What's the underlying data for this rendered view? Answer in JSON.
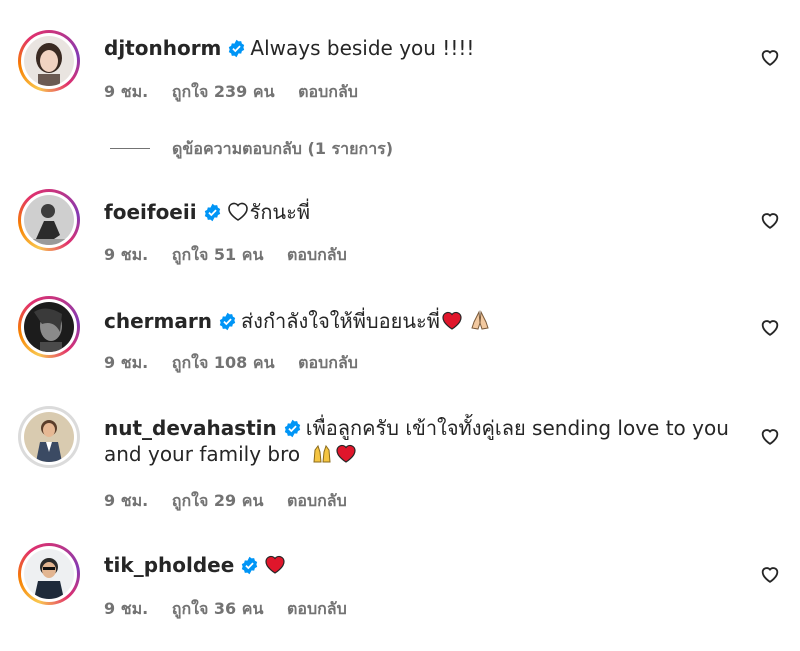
{
  "comments": [
    {
      "username": "djtonhorm",
      "text": "Always beside you !!!!",
      "time": "9 ชม.",
      "likes": "ถูกใจ 239 คน",
      "reply": "ตอบกลับ"
    },
    {
      "username": "foeifoeii",
      "text": "รักนะพี่",
      "time": "9 ชม.",
      "likes": "ถูกใจ 51 คน",
      "reply": "ตอบกลับ"
    },
    {
      "username": "chermarn",
      "text": "ส่งกำลังใจให้พี่บอยนะพี่",
      "time": "9 ชม.",
      "likes": "ถูกใจ 108 คน",
      "reply": "ตอบกลับ"
    },
    {
      "username": "nut_devahastin",
      "text": "เพื่อลูกครับ เข้าใจทั้งคู่เลย sending love to you and your family bro",
      "time": "9 ชม.",
      "likes": "ถูกใจ 29 คน",
      "reply": "ตอบกลับ"
    },
    {
      "username": "tik_pholdee",
      "text": "",
      "time": "9 ชม.",
      "likes": "ถูกใจ 36 คน",
      "reply": "ตอบกลับ"
    }
  ],
  "view_replies": "ดูข้อความตอบกลับ (1 รายการ)",
  "colors": {
    "verified": "#0095f6",
    "muted_text": "#737373",
    "heart_red": "#e0162b"
  }
}
